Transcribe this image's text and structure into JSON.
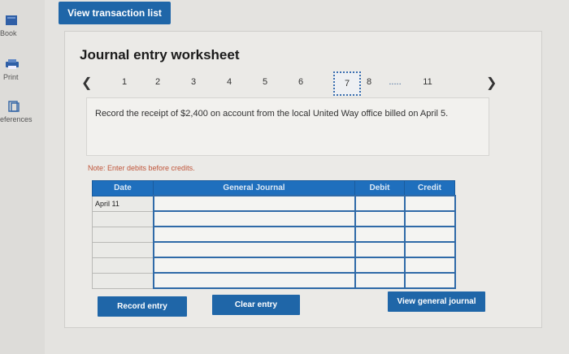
{
  "sidebar": {
    "items": [
      {
        "label": "Book",
        "icon": "book-icon"
      },
      {
        "label": "Print",
        "icon": "printer-icon"
      },
      {
        "label": "eferences",
        "icon": "references-icon"
      }
    ]
  },
  "header": {
    "button_label": "View transaction list"
  },
  "worksheet": {
    "title": "Journal entry worksheet",
    "pager": {
      "pages": [
        "1",
        "2",
        "3",
        "4",
        "5",
        "6",
        "7",
        "8",
        "11"
      ],
      "ellipsis": ".....",
      "active": "7",
      "prev_icon": "chevron-left-icon",
      "next_icon": "chevron-right-icon"
    },
    "prompt": "Record the receipt of $2,400 on account from the local United Way office billed on April 5.",
    "note": "Note: Enter debits before credits.",
    "table": {
      "headers": [
        "Date",
        "General Journal",
        "Debit",
        "Credit"
      ],
      "rows": [
        {
          "date": "April 11",
          "account": "",
          "debit": "",
          "credit": ""
        },
        {
          "date": "",
          "account": "",
          "debit": "",
          "credit": ""
        },
        {
          "date": "",
          "account": "",
          "debit": "",
          "credit": ""
        },
        {
          "date": "",
          "account": "",
          "debit": "",
          "credit": ""
        },
        {
          "date": "",
          "account": "",
          "debit": "",
          "credit": ""
        },
        {
          "date": "",
          "account": "",
          "debit": "",
          "credit": ""
        }
      ]
    },
    "buttons": {
      "record": "Record entry",
      "clear": "Clear entry",
      "view_journal": "View general journal"
    }
  },
  "colors": {
    "accent": "#1f66a8",
    "note": "#c0553a",
    "header_bg": "#1f6fbd"
  }
}
